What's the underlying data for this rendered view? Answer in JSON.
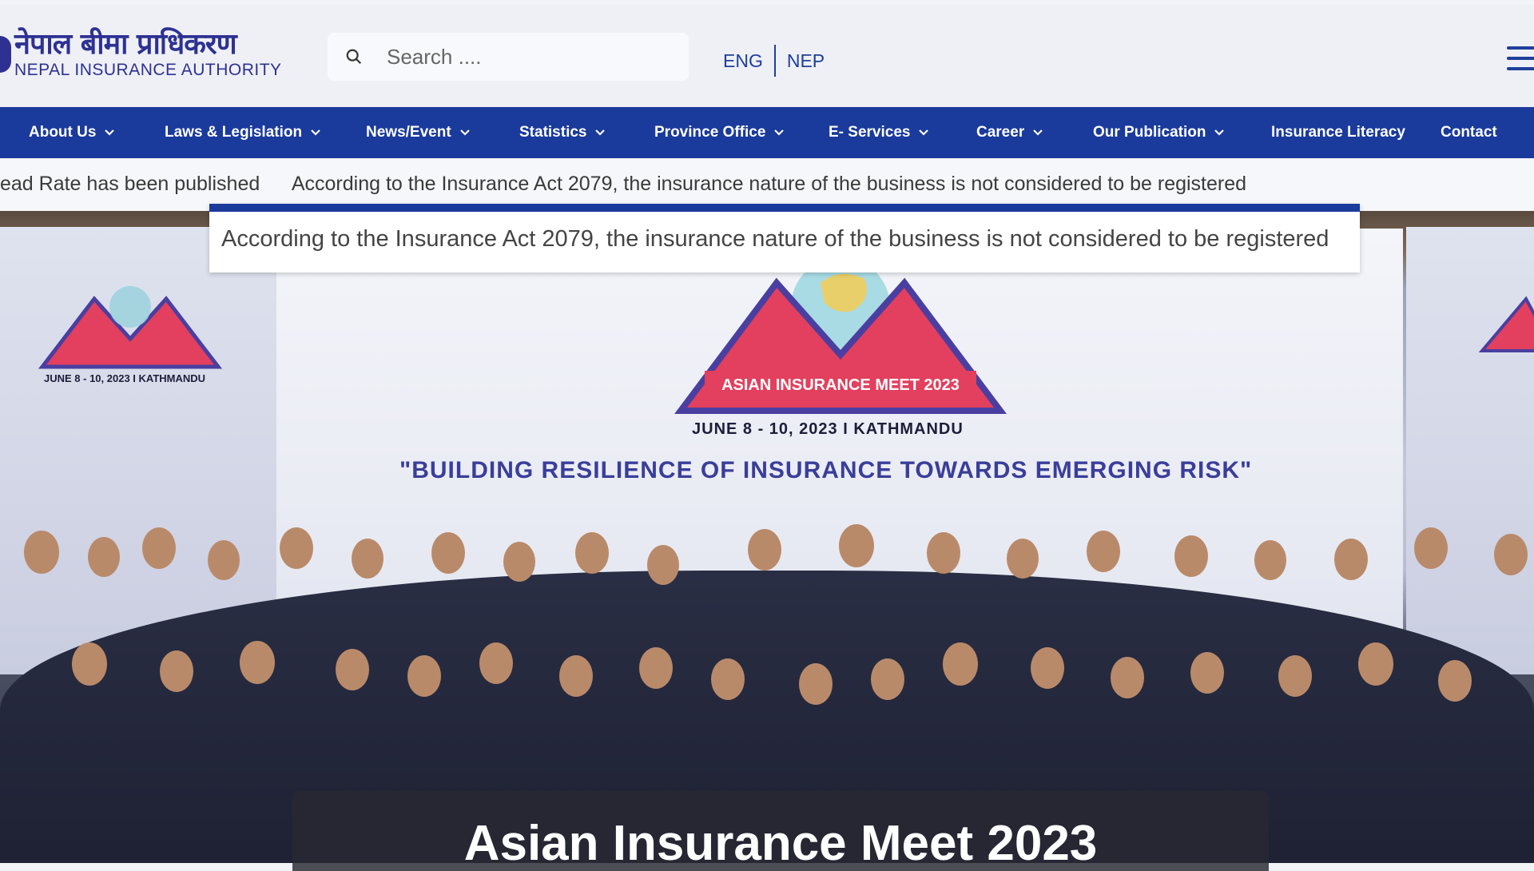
{
  "header": {
    "logo_np": "नेपाल बीमा प्राधिकरण",
    "logo_en": "NEPAL INSURANCE AUTHORITY",
    "search_placeholder": "Search ....",
    "lang_eng": "ENG",
    "lang_nep": "NEP"
  },
  "nav": {
    "items": [
      {
        "label": "About Us",
        "dropdown": true
      },
      {
        "label": "Laws & Legislation",
        "dropdown": true
      },
      {
        "label": "News/Event",
        "dropdown": true
      },
      {
        "label": "Statistics",
        "dropdown": true
      },
      {
        "label": "Province Office",
        "dropdown": true
      },
      {
        "label": "E- Services",
        "dropdown": true
      },
      {
        "label": "Career",
        "dropdown": true
      },
      {
        "label": "Our Publication",
        "dropdown": true
      },
      {
        "label": "Insurance Literacy",
        "dropdown": false
      },
      {
        "label": "Contact",
        "dropdown": false
      }
    ]
  },
  "ticker": {
    "items": [
      "ead Rate has been published",
      "According to the Insurance Act 2079, the insurance nature of the business is not considered to be registered"
    ]
  },
  "popup": {
    "text": "According to the Insurance Act 2079, the insurance nature of the business is not considered to be registered"
  },
  "hero": {
    "banner_title": "ASIAN INSURANCE MEET 2023",
    "banner_date": "JUNE 8 - 10, 2023 I KATHMANDU",
    "slogan": "\"BUILDING RESILIENCE OF INSURANCE TOWARDS EMERGING RISK\"",
    "caption": "Asian Insurance Meet 2023"
  },
  "colors": {
    "brand": "#1a3a9c",
    "logo": "#2e3192",
    "triangle": "#e2405e"
  }
}
